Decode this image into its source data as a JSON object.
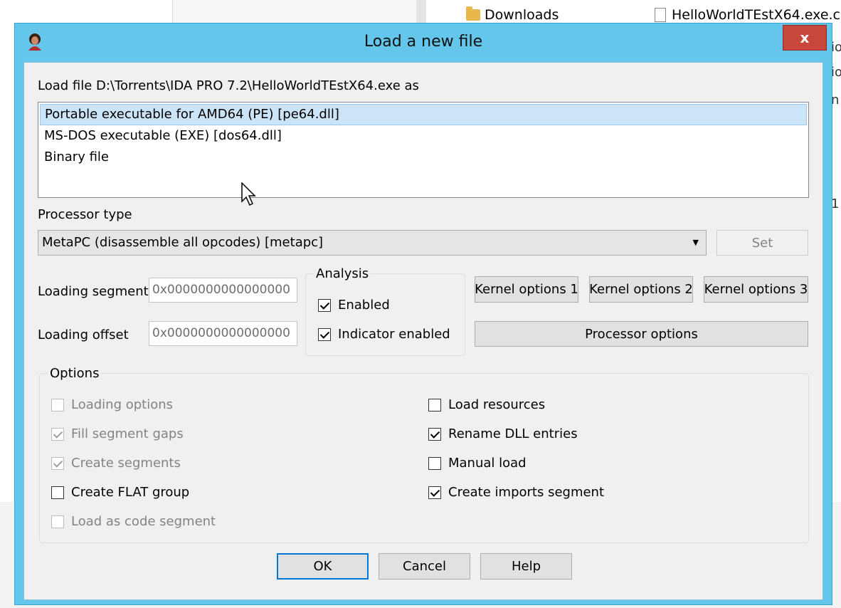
{
  "background": {
    "downloads": "Downloads",
    "file_name": "HelloWorldTEstX64.exe.c",
    "peek": [
      "io",
      "io",
      "n",
      "1"
    ]
  },
  "dialog": {
    "title": "Load a new file",
    "close": "x",
    "load_file_label": "Load file D:\\Torrents\\IDA PRO 7.2\\HelloWorldTEstX64.exe as",
    "loaders": [
      "Portable executable for AMD64 (PE) [pe64.dll]",
      "MS-DOS executable (EXE) [dos64.dll]",
      "Binary file"
    ],
    "processor_type_label": "Processor type",
    "processor_value": "MetaPC (disassemble all opcodes) [metapc]",
    "set_button": "Set",
    "loading_segment_label": "Loading segment",
    "loading_segment_value": "0x0000000000000000",
    "loading_offset_label": "Loading offset",
    "loading_offset_value": "0x0000000000000000",
    "analysis": {
      "title": "Analysis",
      "enabled": "Enabled",
      "indicator": "Indicator enabled"
    },
    "kernel_options": [
      "Kernel options 1",
      "Kernel options 2",
      "Kernel options 3"
    ],
    "processor_options": "Processor options",
    "options": {
      "title": "Options",
      "left": [
        {
          "label": "Loading options",
          "checked": false,
          "disabled": true
        },
        {
          "label": "Fill segment gaps",
          "checked": true,
          "disabled": true
        },
        {
          "label": "Create segments",
          "checked": true,
          "disabled": true
        },
        {
          "label": "Create FLAT group",
          "checked": false,
          "disabled": false
        },
        {
          "label": "Load as code segment",
          "checked": false,
          "disabled": true
        }
      ],
      "right": [
        {
          "label": "Load resources",
          "checked": false,
          "disabled": false
        },
        {
          "label": "Rename DLL entries",
          "checked": true,
          "disabled": false
        },
        {
          "label": "Manual load",
          "checked": false,
          "disabled": false
        },
        {
          "label": "Create imports segment",
          "checked": true,
          "disabled": false
        }
      ]
    },
    "buttons": {
      "ok": "OK",
      "cancel": "Cancel",
      "help": "Help"
    }
  }
}
